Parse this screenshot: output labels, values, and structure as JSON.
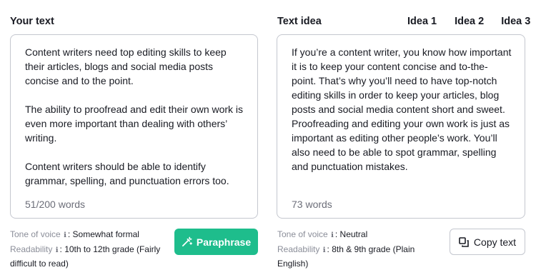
{
  "left": {
    "title": "Your text",
    "paragraphs": [
      "Content writers need top editing skills to keep their articles, blogs and social media posts concise and to the point.",
      "The ability to proofread and edit their own work is even more important than dealing with others’ writing.",
      "Content writers should be able to identify grammar, spelling, and punctuation errors too."
    ],
    "word_count": "51/200 words",
    "tone_label": "Tone of voice",
    "tone_value": "Somewhat formal",
    "readability_label": "Readability",
    "readability_value": "10th to 12th grade (Fairly difficult to read)",
    "paraphrase_label": "Paraphrase"
  },
  "right": {
    "title": "Text idea",
    "tabs": [
      "Idea 1",
      "Idea 2",
      "Idea 3"
    ],
    "active_tab": 0,
    "text": "If you’re a content writer, you know how important it is to keep your content concise and to-the-point. That’s why you’ll need to have top-notch editing skills in order to keep your articles, blog posts and social media content short and sweet. Proofreading and editing your own work is just as important as editing other people’s work. You’ll also need to be able to spot grammar, spelling and punctuation mistakes.",
    "word_count": "73 words",
    "tone_label": "Tone of voice",
    "tone_value": "Neutral",
    "readability_label": "Readability",
    "readability_value": "8th & 9th grade (Plain English)",
    "copy_label": "Copy text"
  },
  "icons": {
    "info": "info-icon",
    "paraphrase": "magic-wand-icon",
    "copy": "copy-icon"
  },
  "colors": {
    "accent_green": "#1ebd8c",
    "tab_underline": "#ff642d",
    "muted_text": "#8b8e99",
    "border": "#c4c7cf"
  }
}
